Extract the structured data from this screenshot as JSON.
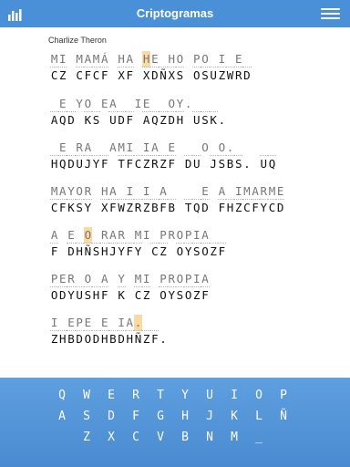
{
  "header": {
    "title": "Criptogramas",
    "stats_icon": "bar-chart-icon",
    "menu_icon": "hamburger-menu-icon"
  },
  "puzzle": {
    "author": "Charlize Theron",
    "lines": [
      {
        "guess": "MI MAMÁ HA HE HO PO I E",
        "code": "CZ CFCF XF XDÑXS OSUZWRD",
        "hl": [
          11
        ]
      },
      {
        "guess": " E YO EA  IE  OY.",
        "code": "AQD KS UDF AQZDH USK.",
        "hl": []
      },
      {
        "guess": " E RA  AMI IA E   O O.",
        "code": "HQDUJYF TFCZRZF DU JSBS. UQ",
        "hl": []
      },
      {
        "guess": "MAYOR HA I I A    E A IMARME",
        "code": "CFKSY XFWZRZBFB TQD FHZCFYCD",
        "hl": []
      },
      {
        "guess": "A E O RAR MI PROPIA",
        "code": "F DHÑSHJYFY CZ OYSOZF",
        "hl": [
          4
        ]
      },
      {
        "guess": "PER O A Y MI PROPIA",
        "code": "ODYUSHF K CZ OYSOZF",
        "hl": []
      },
      {
        "guess": "I EPE E IA.",
        "code": "ZHBDODHBDHÑZF.",
        "hl": [
          10
        ]
      }
    ]
  },
  "keyboard": {
    "rows": [
      [
        "Q",
        "W",
        "E",
        "R",
        "T",
        "Y",
        "U",
        "I",
        "O",
        "P"
      ],
      [
        "A",
        "S",
        "D",
        "F",
        "G",
        "H",
        "J",
        "K",
        "L",
        "Ñ"
      ],
      [
        "Z",
        "X",
        "C",
        "V",
        "B",
        "N",
        "M",
        "_"
      ]
    ]
  }
}
